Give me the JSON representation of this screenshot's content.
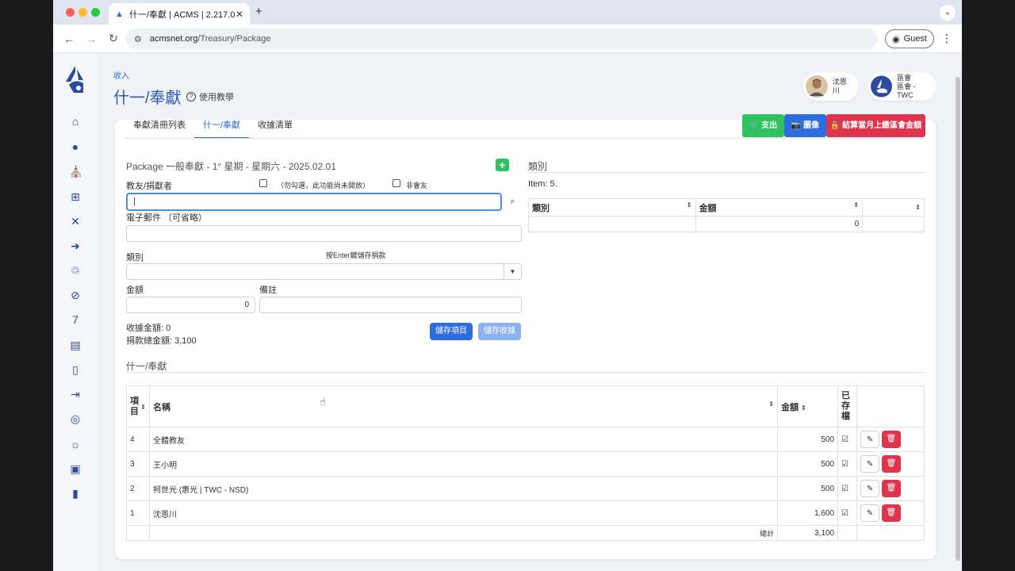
{
  "browser": {
    "tab_title": "什一/奉獻 | ACMS | 2.217.0",
    "url_host": "acmsnet.org",
    "url_path": "/Treasury/Package",
    "guest_label": "Guest"
  },
  "breadcrumb": "收入",
  "page_title": "什一/奉獻",
  "help_label": "使用教學",
  "users": [
    {
      "name": "沈恩川"
    },
    {
      "name": "區會",
      "sub": "區會 - TWC"
    }
  ],
  "tabs": [
    "奉獻清冊列表",
    "什一/奉獻",
    "收據清單"
  ],
  "actions": {
    "expense": "支出",
    "image": "圖像",
    "close_month": "結算當月上繳區會金額"
  },
  "form": {
    "package_title": "Package 一般奉獻 - 1° 星期 - 星期六 - 2025.02.01",
    "donor_label": "教友/捐獻者",
    "donor_check_label": "（勿勾選，此功能尚未開放）",
    "non_member_label": "非會友",
    "email_label": "電子郵件 （可省略）",
    "category_label": "類別",
    "enter_hint": "按Enter鍵儲存捐款",
    "amount_label": "金額",
    "amount_value": "0",
    "note_label": "備註",
    "receipt_amount": "收據金額: 0",
    "total_amount": "捐款總金額: 3,100",
    "save_item": "儲存項目",
    "save_receipt": "儲存收據"
  },
  "category_panel": {
    "title": "類別",
    "item_count": "Item: 5.",
    "headers": [
      "類別",
      "金額",
      ""
    ],
    "rows": [
      {
        "category": "",
        "amount": "0"
      }
    ]
  },
  "list": {
    "title": "什一/奉獻",
    "headers": {
      "item": "項目",
      "name": "名稱",
      "amount": "金額",
      "filed": "已存檔"
    },
    "rows": [
      {
        "item": "4",
        "name": "全體教友",
        "amount": "500"
      },
      {
        "item": "3",
        "name": "王小明",
        "amount": "500"
      },
      {
        "item": "2",
        "name": "柯世光 (惠光 | TWC - NSD)",
        "amount": "500"
      },
      {
        "item": "1",
        "name": "沈恩川",
        "amount": "1,600"
      }
    ],
    "total_label": "總計",
    "total_value": "3,100"
  },
  "colors": {
    "primary": "#2c6ad0",
    "success": "#2fc25f",
    "danger": "#e0344e",
    "navy": "#2c4a9e"
  }
}
